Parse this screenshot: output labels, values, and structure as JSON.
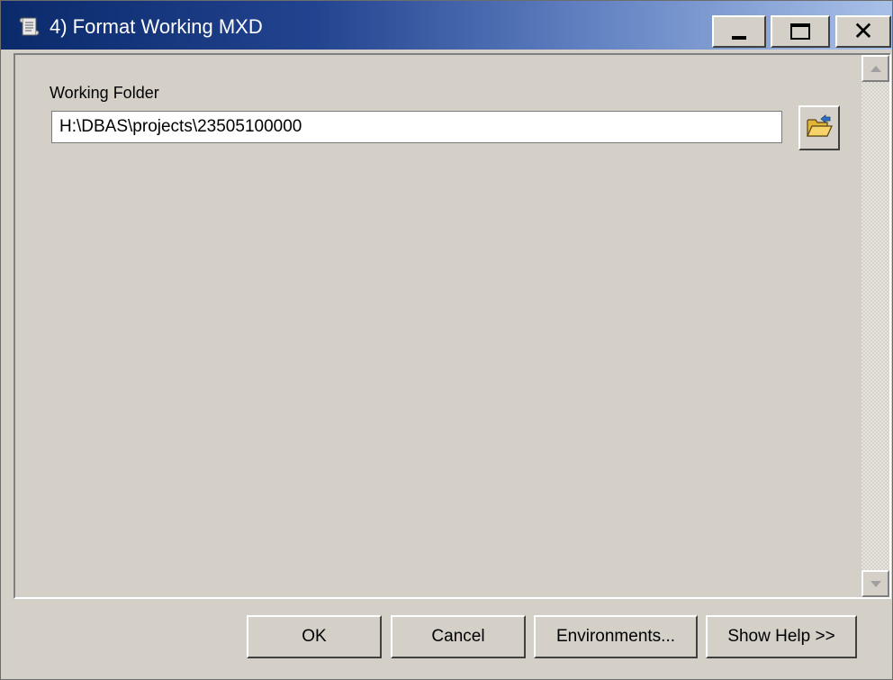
{
  "window": {
    "title": "4) Format Working MXD",
    "app_icon": "script-tool-icon",
    "controls": {
      "minimize": "_",
      "maximize": "☐",
      "close": "✕"
    }
  },
  "form": {
    "working_folder_label": "Working Folder",
    "working_folder_value": "H:\\DBAS\\projects\\23505100000",
    "browse_icon": "open-folder-icon"
  },
  "buttons": {
    "ok": "OK",
    "cancel": "Cancel",
    "environments": "Environments...",
    "show_help": "Show Help >>"
  },
  "colors": {
    "title_gradient_start": "#0a2a6b",
    "title_gradient_end": "#a9c1e8",
    "dialog_face": "#d4d0c8"
  }
}
